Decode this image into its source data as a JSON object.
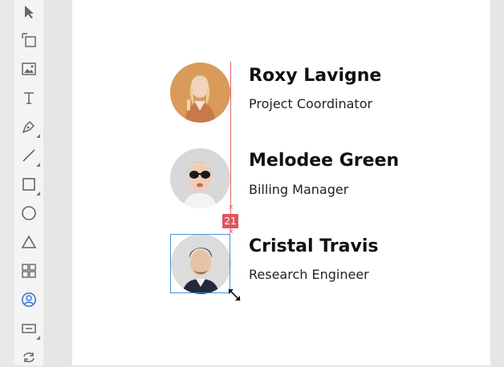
{
  "toolbar": {
    "tools": [
      {
        "id": "select",
        "icon": "select-arrow-icon"
      },
      {
        "id": "component",
        "icon": "component-icon"
      },
      {
        "id": "image",
        "icon": "image-icon"
      },
      {
        "id": "text",
        "icon": "text-icon"
      },
      {
        "id": "pen",
        "icon": "pen-icon"
      },
      {
        "id": "line",
        "icon": "line-icon"
      },
      {
        "id": "rectangle",
        "icon": "rectangle-icon"
      },
      {
        "id": "ellipse",
        "icon": "ellipse-icon"
      },
      {
        "id": "triangle",
        "icon": "triangle-icon"
      },
      {
        "id": "grid",
        "icon": "grid-icon"
      },
      {
        "id": "avatar",
        "icon": "user-avatar-icon",
        "active": true
      },
      {
        "id": "input",
        "icon": "input-field-icon"
      },
      {
        "id": "repeat",
        "icon": "repeat-icon"
      }
    ],
    "active_color": "#3a7bd5"
  },
  "people": [
    {
      "name": "Roxy Lavigne",
      "role": "Project Coordinator"
    },
    {
      "name": "Melodee Green",
      "role": "Billing Manager"
    },
    {
      "name": "Cristal Travis",
      "role": "Research Engineer"
    }
  ],
  "spacing_guide": {
    "value": "21",
    "color": "#e05560"
  },
  "selection": {
    "color": "#4a90d9"
  }
}
